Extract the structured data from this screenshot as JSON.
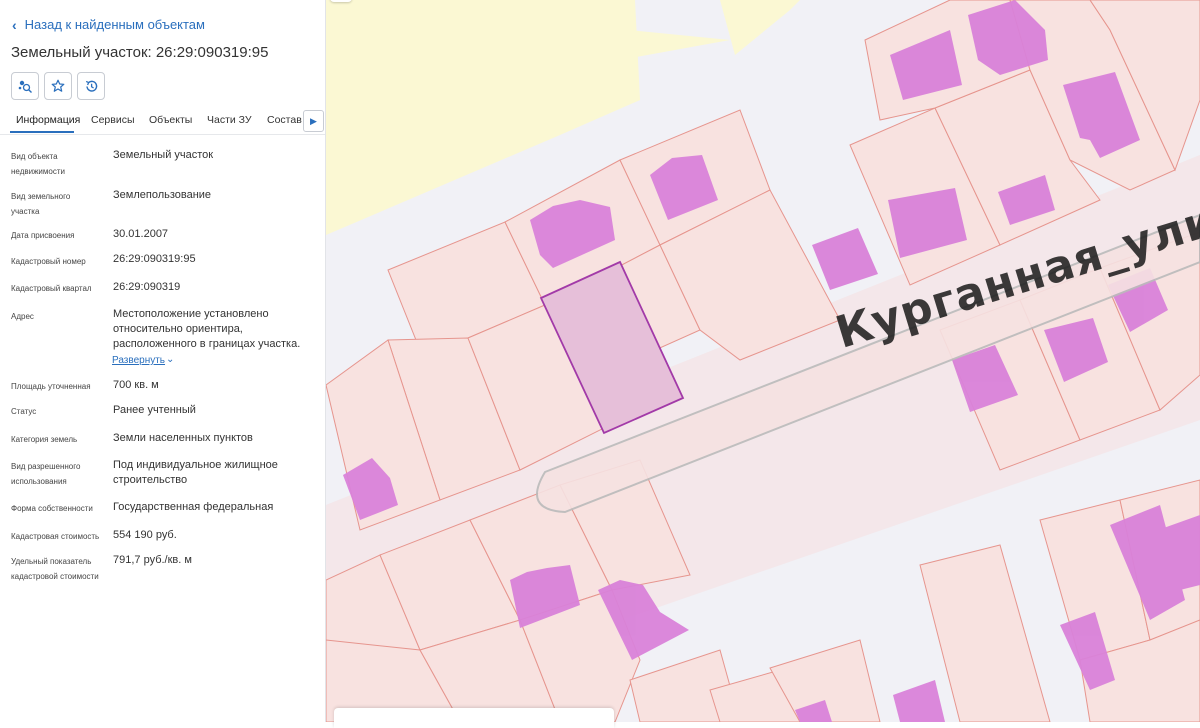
{
  "panel": {
    "back_link": "Назад к найденным объектам",
    "title": "Земельный участок: 26:29:090319:95",
    "tabs": [
      {
        "label": "Информация"
      },
      {
        "label": "Сервисы"
      },
      {
        "label": "Объекты"
      },
      {
        "label": "Части ЗУ"
      },
      {
        "label": "Состав Е"
      }
    ],
    "rows": [
      {
        "label": "Вид объекта недвижимости",
        "value": "Земельный участок"
      },
      {
        "label": "Вид земельного участка",
        "value": "Землепользование"
      },
      {
        "label": "Дата присвоения",
        "value": "30.01.2007"
      },
      {
        "label": "Кадастровый номер",
        "value": "26:29:090319:95"
      },
      {
        "label": "Кадастровый квартал",
        "value": "26:29:090319"
      },
      {
        "label": "Адрес",
        "value": "Местоположение установлено относительно ориентира, расположенного в границах участка."
      },
      {
        "label": "Площадь уточненная",
        "value": "700 кв. м"
      },
      {
        "label": "Статус",
        "value": "Ранее учтенный"
      },
      {
        "label": "Категория земель",
        "value": "Земли населенных пунктов"
      },
      {
        "label": "Вид разрешенного использования",
        "value": "Под индивидуальное жилищное строительство"
      },
      {
        "label": "Форма собственности",
        "value": "Государственная федеральная"
      },
      {
        "label": "Кадастровая стоимость",
        "value": "554 190 руб."
      },
      {
        "label": "Удельный показатель кадастровой стоимости",
        "value": "791,7 руб./кв. м"
      }
    ],
    "expand_link": "Развернуть",
    "icons": [
      "map-layers-search-icon",
      "star-icon",
      "history-icon"
    ]
  },
  "map": {
    "street_label": "Курганная_улиц",
    "colors": {
      "background": "#f1f1f6",
      "yellow_zone": "#fbf8d3",
      "parcel_fill": "#f8e2e0",
      "parcel_stroke": "#e6958e",
      "building": "#d982d9",
      "selected_fill": "#e6bfd9",
      "selected_stroke": "#a23aa8",
      "accent": "#2a6fbd"
    }
  }
}
